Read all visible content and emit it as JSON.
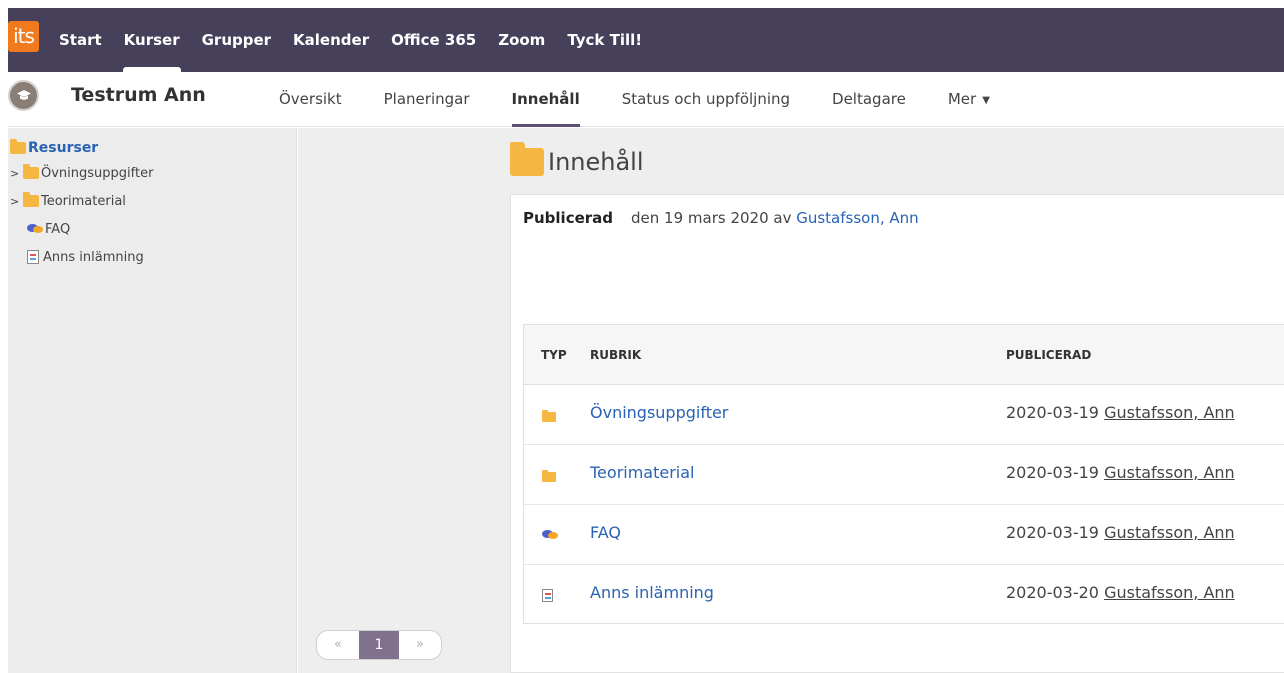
{
  "brand": {
    "logo_text": "its",
    "color": "#f07b1e"
  },
  "topnav": {
    "items": [
      {
        "label": "Start"
      },
      {
        "label": "Kurser",
        "active": true
      },
      {
        "label": "Grupper"
      },
      {
        "label": "Kalender"
      },
      {
        "label": "Office 365"
      },
      {
        "label": "Zoom"
      },
      {
        "label": "Tyck Till!"
      }
    ],
    "background": "#47405a"
  },
  "course": {
    "title": "Testrum Ann",
    "tabs": [
      {
        "label": "Översikt"
      },
      {
        "label": "Planeringar"
      },
      {
        "label": "Innehåll",
        "active": true
      },
      {
        "label": "Status och uppföljning"
      },
      {
        "label": "Deltagare"
      },
      {
        "label": "Mer"
      }
    ]
  },
  "sidebar": {
    "root": "Resurser",
    "items": [
      {
        "label": "Övningsuppgifter",
        "icon": "folder-icon",
        "expandable": true
      },
      {
        "label": "Teorimaterial",
        "icon": "folder-icon",
        "expandable": true
      },
      {
        "label": "FAQ",
        "icon": "forum-icon",
        "expandable": false
      },
      {
        "label": "Anns inlämning",
        "icon": "assignment-icon",
        "expandable": false
      }
    ]
  },
  "content": {
    "heading": "Innehåll",
    "published_label": "Publicerad",
    "published_text": "den 19 mars 2020 av ",
    "published_author": "Gustafsson, Ann",
    "table": {
      "headers": {
        "type": "TYP",
        "title": "RUBRIK",
        "published": "PUBLICERAD"
      },
      "rows": [
        {
          "icon": "folder-icon",
          "title": "Övningsuppgifter",
          "date": "2020-03-19",
          "author": "Gustafsson, Ann"
        },
        {
          "icon": "folder-icon",
          "title": "Teorimaterial",
          "date": "2020-03-19",
          "author": "Gustafsson, Ann"
        },
        {
          "icon": "forum-icon",
          "title": "FAQ",
          "date": "2020-03-19",
          "author": "Gustafsson, Ann"
        },
        {
          "icon": "assignment-icon",
          "title": "Anns inlämning",
          "date": "2020-03-20",
          "author": "Gustafsson, Ann"
        }
      ]
    },
    "pagination": {
      "prev": "«",
      "current": "1",
      "next": "»"
    }
  },
  "colors": {
    "accent": "#5e4f70",
    "link": "#2a62b4",
    "folder": "#f5b642",
    "page_current": "#80728f"
  }
}
